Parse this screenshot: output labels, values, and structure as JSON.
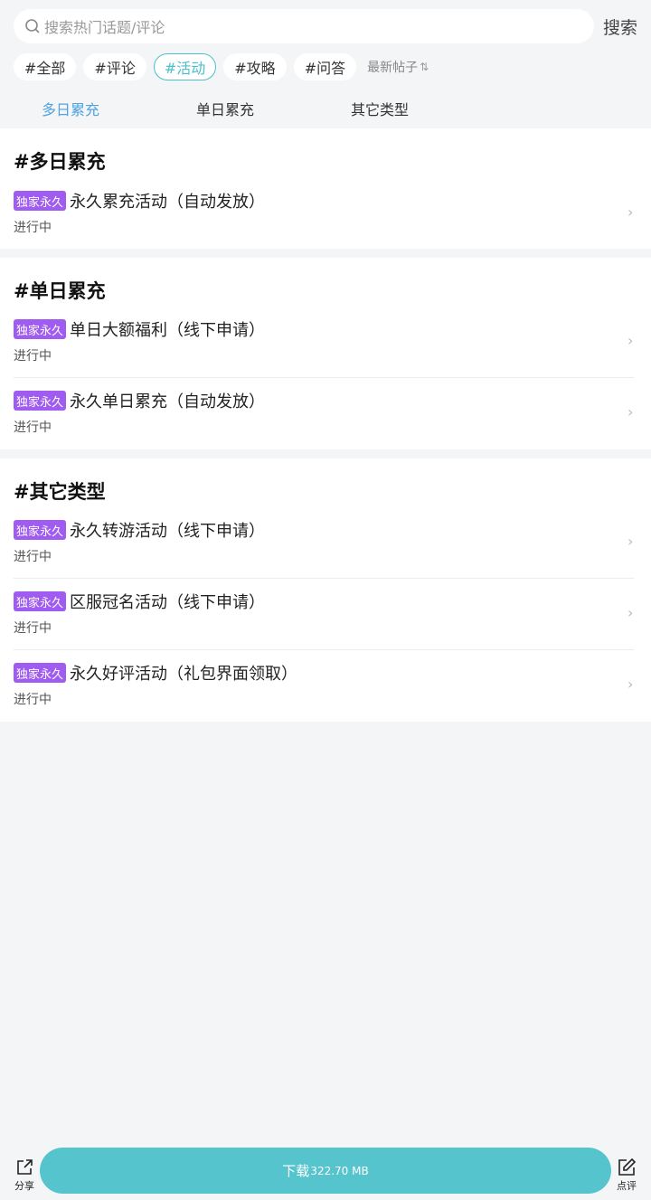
{
  "search": {
    "placeholder": "搜索热门话题/评论",
    "button": "搜索"
  },
  "chips": [
    "#全部",
    "#评论",
    "#活动",
    "#攻略",
    "#问答"
  ],
  "sort_label": "最新帖子",
  "tabs": [
    "多日累充",
    "单日累充",
    "其它类型"
  ],
  "sections": [
    {
      "title": "#多日累充",
      "items": [
        {
          "badge": "独家永久",
          "title": "永久累充活动（自动发放）",
          "status": "进行中"
        }
      ]
    },
    {
      "title": "#单日累充",
      "items": [
        {
          "badge": "独家永久",
          "title": "单日大额福利（线下申请）",
          "status": "进行中"
        },
        {
          "badge": "独家永久",
          "title": "永久单日累充（自动发放）",
          "status": "进行中"
        }
      ]
    },
    {
      "title": "#其它类型",
      "items": [
        {
          "badge": "独家永久",
          "title": "永久转游活动（线下申请）",
          "status": "进行中"
        },
        {
          "badge": "独家永久",
          "title": "区服冠名活动（线下申请）",
          "status": "进行中"
        },
        {
          "badge": "独家永久",
          "title": "永久好评活动（礼包界面领取）",
          "status": "进行中"
        }
      ]
    }
  ],
  "bottom": {
    "share": "分享",
    "download": "下载",
    "size": "322.70 MB",
    "review": "点评"
  },
  "colors": {
    "accent": "#55c4cd",
    "tab_active": "#4fa3e0",
    "badge": "#a05cf0"
  }
}
